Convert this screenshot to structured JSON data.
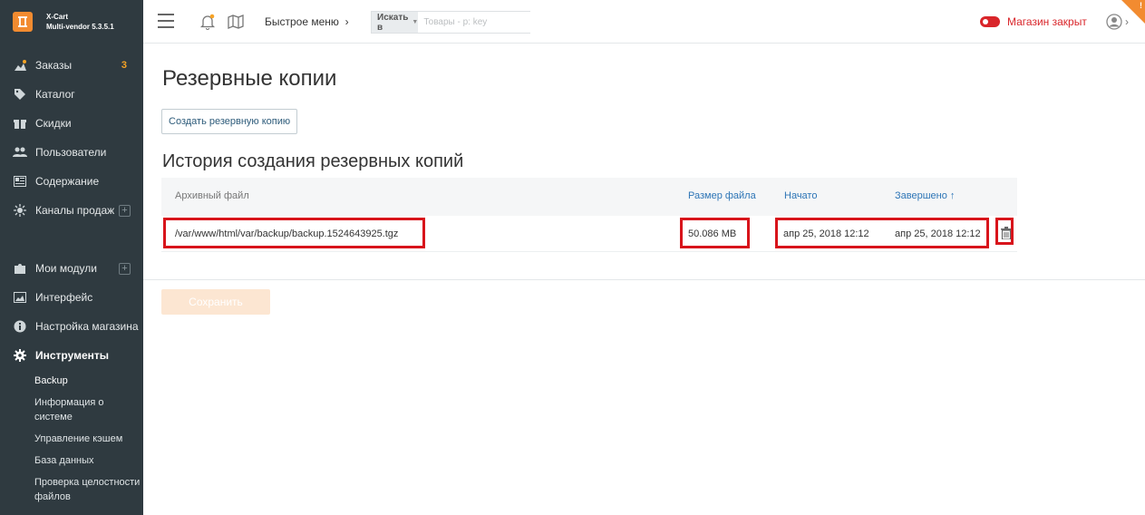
{
  "app": {
    "name": "X-Cart",
    "version": "Multi-vendor 5.3.5.1"
  },
  "sidebar": {
    "items": [
      {
        "label": "Заказы",
        "badge": "3",
        "icon": "orders-icon"
      },
      {
        "label": "Каталог",
        "icon": "tag-icon"
      },
      {
        "label": "Скидки",
        "icon": "gift-icon"
      },
      {
        "label": "Пользователи",
        "icon": "users-icon"
      },
      {
        "label": "Содержание",
        "icon": "content-icon"
      },
      {
        "label": "Каналы продаж",
        "icon": "sales-channels-icon",
        "expand": "+"
      },
      {
        "label": "Мои модули",
        "icon": "puzzle-icon",
        "expand": "+"
      },
      {
        "label": "Интерфейс",
        "icon": "image-icon"
      },
      {
        "label": "Настройка магазина",
        "icon": "info-icon"
      },
      {
        "label": "Инструменты",
        "icon": "gear-icon",
        "active": true
      }
    ],
    "sub_items": [
      {
        "label": "Backup",
        "current": true
      },
      {
        "label": "Информация о системе"
      },
      {
        "label": "Управление кэшем"
      },
      {
        "label": "База данных"
      },
      {
        "label": "Проверка целостности файлов"
      }
    ]
  },
  "topbar": {
    "quick_menu": "Быстрое меню",
    "search_in": "Искать в",
    "search_placeholder": "Товары - р: key",
    "store_status": "Магазин закрыт",
    "corner_mark": "!"
  },
  "main": {
    "title": "Резервные копии",
    "create_button": "Создать резервную копию",
    "history_title": "История создания резервных копий",
    "columns": {
      "file": "Архивный файл",
      "size": "Размер файла",
      "started": "Начато",
      "finished": "Завершено ↑"
    },
    "rows": [
      {
        "file": "/var/www/html/var/backup/backup.1524643925.tgz",
        "size": "50.086 MB",
        "started": "апр 25, 2018 12:12",
        "finished": "апр 25, 2018 12:12"
      }
    ],
    "save_button": "Сохранить"
  },
  "colors": {
    "sidebar_bg": "#2f3a40",
    "accent": "#f28b30",
    "link": "#2d75b6",
    "highlight": "#d8141b",
    "status_closed": "#d9252a"
  }
}
